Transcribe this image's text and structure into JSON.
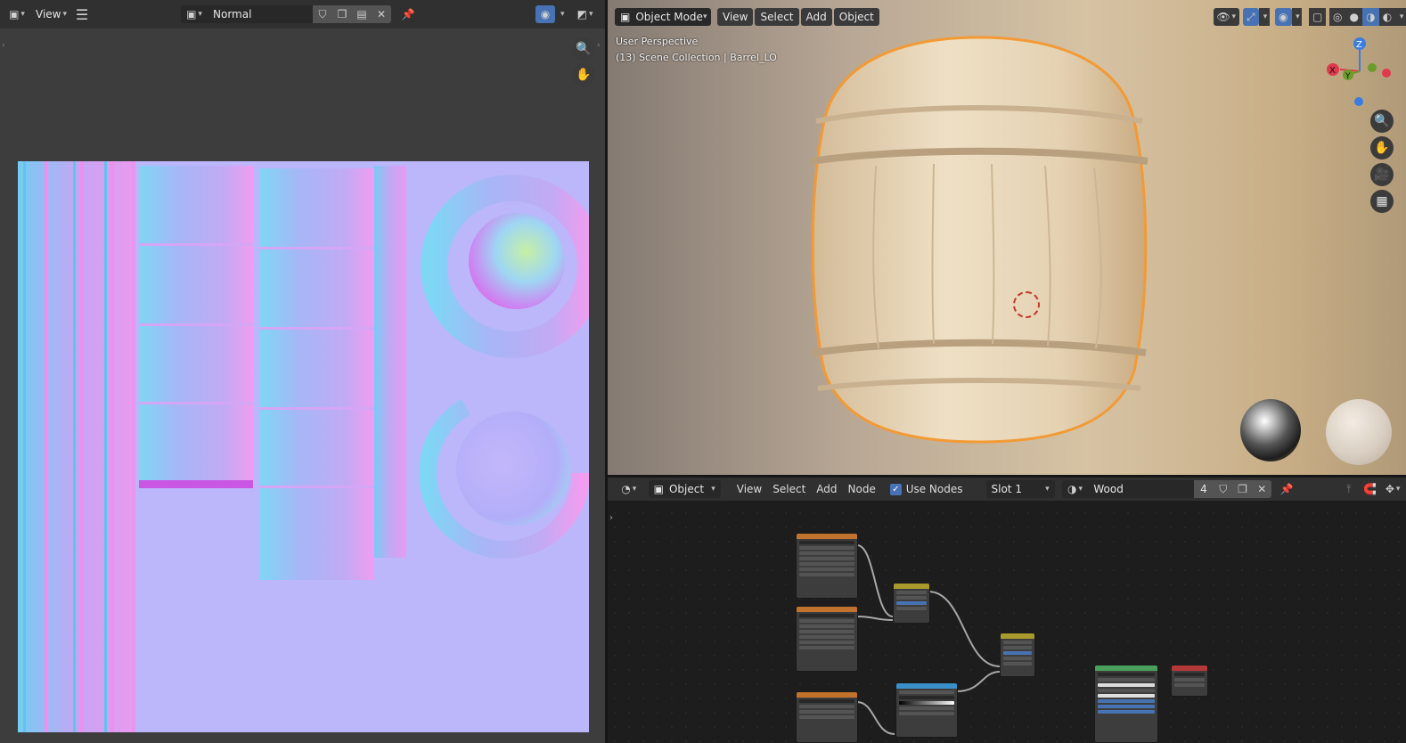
{
  "image_editor": {
    "view_menu": "View",
    "image_name": "Normal"
  },
  "viewport": {
    "mode": "Object Mode",
    "menus": [
      "View",
      "Select",
      "Add",
      "Object"
    ],
    "overlay_line1": "User Perspective",
    "overlay_line2": "(13) Scene Collection | Barrel_LO",
    "gizmo_axes": {
      "z": "Z",
      "x": "X",
      "y": "Y"
    },
    "colors": {
      "x_axis": "#e0394c",
      "y_axis": "#6b9b2a",
      "z_axis": "#3a7ce0",
      "selection_outline": "#f39a35"
    }
  },
  "node_editor": {
    "editor_type": "Object",
    "menus": [
      "View",
      "Select",
      "Add",
      "Node"
    ],
    "use_nodes_label": "Use Nodes",
    "use_nodes_checked": true,
    "slot": "Slot 1",
    "material_name": "Wood",
    "user_count": "4"
  },
  "icons": {
    "image_editor": [
      "image-editor-type-icon",
      "hamburger-menu-icon",
      "image-browse-icon",
      "fake-user-shield-icon",
      "new-image-icon",
      "open-image-icon",
      "close-icon",
      "pin-icon",
      "overlay-icon",
      "display-channels-icon",
      "zoom-icon",
      "pan-hand-icon"
    ],
    "viewport": [
      "object-mode-icon",
      "visibility-icon",
      "gizmo-icon",
      "overlay-icon",
      "xray-icon",
      "wireframe-shading-icon",
      "solid-shading-icon",
      "material-shading-icon",
      "rendered-shading-icon",
      "zoom-icon",
      "pan-hand-icon",
      "camera-icon",
      "grid-icon",
      "3d-cursor-icon"
    ],
    "node_editor": [
      "node-editor-type-icon",
      "object-icon",
      "material-browse-icon",
      "fake-user-shield-icon",
      "duplicate-icon",
      "close-icon",
      "pin-icon",
      "parent-node-icon",
      "snap-icon",
      "view-icon"
    ]
  }
}
